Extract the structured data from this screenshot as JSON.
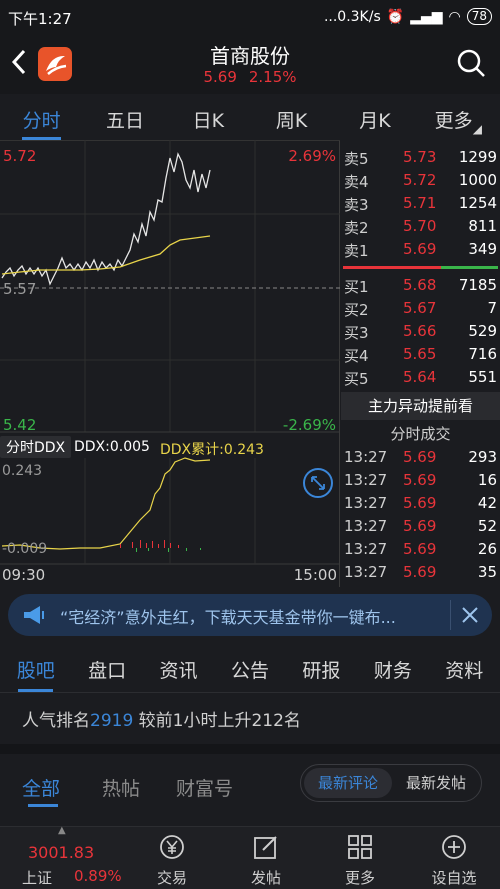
{
  "status_bar": {
    "time": "下午1:27",
    "network": "...0.3K/s",
    "battery": "78"
  },
  "header": {
    "title": "首商股份",
    "price": "5.69",
    "change_pct": "2.15%"
  },
  "tabs": [
    "分时",
    "五日",
    "日K",
    "周K",
    "月K",
    "更多"
  ],
  "chart": {
    "high_price": "5.72",
    "high_pct": "2.69%",
    "low_price": "5.42",
    "low_pct": "-2.69%",
    "ref_price": "5.57",
    "indicator_btn": "分时DDX",
    "ddx": "DDX:0.005",
    "ddx_cum": "DDX累计:0.243",
    "ddx_top": "0.243",
    "ddx_bottom": "-0.009",
    "time_start": "09:30",
    "time_end": "15:00"
  },
  "order_book": {
    "sells": [
      {
        "label": "卖5",
        "price": "5.73",
        "vol": "1299"
      },
      {
        "label": "卖4",
        "price": "5.72",
        "vol": "1000"
      },
      {
        "label": "卖3",
        "price": "5.71",
        "vol": "1254"
      },
      {
        "label": "卖2",
        "price": "5.70",
        "vol": "811"
      },
      {
        "label": "卖1",
        "price": "5.69",
        "vol": "349"
      }
    ],
    "buys": [
      {
        "label": "买1",
        "price": "5.68",
        "vol": "7185"
      },
      {
        "label": "买2",
        "price": "5.67",
        "vol": "7"
      },
      {
        "label": "买3",
        "price": "5.66",
        "vol": "529"
      },
      {
        "label": "买4",
        "price": "5.65",
        "vol": "716"
      },
      {
        "label": "买5",
        "price": "5.64",
        "vol": "551"
      }
    ],
    "main_btn": "主力异动提前看",
    "trades_title": "分时成交",
    "trades": [
      {
        "time": "13:27",
        "price": "5.69",
        "vol": "293"
      },
      {
        "time": "13:27",
        "price": "5.69",
        "vol": "16"
      },
      {
        "time": "13:27",
        "price": "5.69",
        "vol": "42"
      },
      {
        "time": "13:27",
        "price": "5.69",
        "vol": "52"
      },
      {
        "time": "13:27",
        "price": "5.69",
        "vol": "26"
      },
      {
        "time": "13:27",
        "price": "5.69",
        "vol": "35"
      }
    ]
  },
  "banner": {
    "text": "“宅经济”意外走红，下载天天基金带你一键布..."
  },
  "lower_tabs": [
    "股吧",
    "盘口",
    "资讯",
    "公告",
    "研报",
    "财务",
    "资料"
  ],
  "popularity": {
    "prefix": "人气排名",
    "rank": "2919",
    "suffix": " 较前1小时上升212名"
  },
  "sub_tabs": [
    "全部",
    "热帖",
    "财富号"
  ],
  "sort_pill": {
    "a": "最新评论",
    "b": "最新发帖"
  },
  "bottom": {
    "index_value": "3001.83",
    "index_name": "上证",
    "index_change": "0.89%",
    "nav": [
      "交易",
      "发帖",
      "更多",
      "设自选"
    ]
  },
  "colors": {
    "red": "#e8343a",
    "green": "#3ab54a",
    "accent": "#3b86d8",
    "bg": "#1b1c20"
  }
}
